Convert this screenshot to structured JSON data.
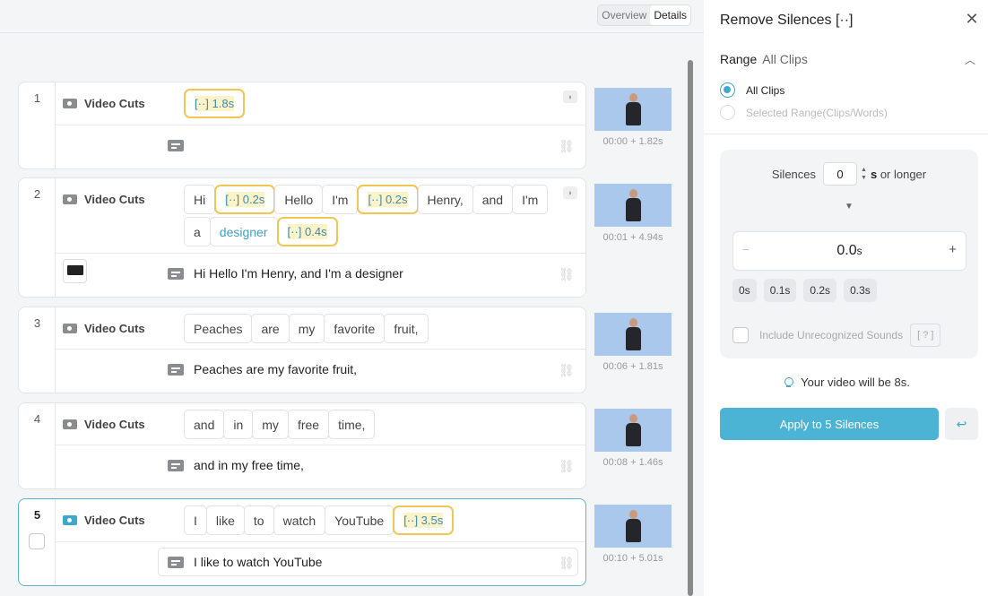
{
  "toolbar": {
    "overview_label": "Overview",
    "details_label": "Details"
  },
  "clips": [
    {
      "number": "1",
      "track_label": "Video Cuts",
      "words": [
        {
          "type": "silence",
          "text": "[··] 1.8s"
        }
      ],
      "subtitle": "",
      "thumb_time": "00:00 + 1.82s"
    },
    {
      "number": "2",
      "track_label": "Video Cuts",
      "words": [
        {
          "type": "word",
          "text": "Hi"
        },
        {
          "type": "silence",
          "text": "[··] 0.2s"
        },
        {
          "type": "word",
          "text": "Hello"
        },
        {
          "type": "word",
          "text": "I'm"
        },
        {
          "type": "silence",
          "text": "[··] 0.2s"
        },
        {
          "type": "word",
          "text": "Henry,"
        },
        {
          "type": "word",
          "text": "and"
        },
        {
          "type": "word",
          "text": "I'm"
        },
        {
          "type": "word",
          "text": "a"
        },
        {
          "type": "word",
          "text": "designer",
          "highlight": true
        },
        {
          "type": "silence",
          "text": "[··] 0.4s"
        }
      ],
      "subtitle": "Hi Hello I'm Henry, and I'm a designer",
      "thumb_time": "00:01 + 4.94s"
    },
    {
      "number": "3",
      "track_label": "Video Cuts",
      "words": [
        {
          "type": "word",
          "text": "Peaches"
        },
        {
          "type": "word",
          "text": "are"
        },
        {
          "type": "word",
          "text": "my"
        },
        {
          "type": "word",
          "text": "favorite"
        },
        {
          "type": "word",
          "text": "fruit,"
        }
      ],
      "subtitle": "Peaches are my favorite fruit,",
      "thumb_time": "00:06 + 1.81s"
    },
    {
      "number": "4",
      "track_label": "Video Cuts",
      "words": [
        {
          "type": "word",
          "text": "and"
        },
        {
          "type": "word",
          "text": "in"
        },
        {
          "type": "word",
          "text": "my"
        },
        {
          "type": "word",
          "text": "free"
        },
        {
          "type": "word",
          "text": "time,"
        }
      ],
      "subtitle": "and in my free time,",
      "thumb_time": "00:08 + 1.46s"
    },
    {
      "number": "5",
      "track_label": "Video Cuts",
      "words": [
        {
          "type": "word",
          "text": "I"
        },
        {
          "type": "word",
          "text": "like"
        },
        {
          "type": "word",
          "text": "to"
        },
        {
          "type": "word",
          "text": "watch"
        },
        {
          "type": "word",
          "text": "YouTube"
        },
        {
          "type": "silence",
          "text": "[··] 3.5s"
        }
      ],
      "subtitle": "I like to watch YouTube",
      "thumb_time": "00:10 + 5.01s"
    }
  ],
  "panel": {
    "title": "Remove Silences [··]",
    "range_label": "Range",
    "range_value": "All Clips",
    "radio_all": "All Clips",
    "radio_selected": "Selected Range(Clips/Words)",
    "silences_label": "Silences",
    "silences_value": "0",
    "silences_unit": "s",
    "silences_suffix": "or longer",
    "duration_value": "0.0",
    "duration_unit": "s",
    "presets": [
      "0s",
      "0.1s",
      "0.2s",
      "0.3s"
    ],
    "unrecognized_label": "Include Unrecognized Sounds",
    "unrecognized_help": "[ ? ]",
    "estimate": "Your video will be 8s.",
    "apply_label": "Apply to 5 Silences",
    "accent": "#4bb3d3"
  }
}
